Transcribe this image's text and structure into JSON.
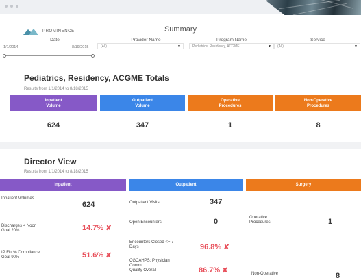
{
  "window": {
    "brand": "PROMINENCE",
    "title": "Summary"
  },
  "filters": {
    "date": {
      "label": "Date",
      "start": "1/1/2014",
      "end": "8/19/2015"
    },
    "provider": {
      "label": "Provider Name",
      "value": "(All)"
    },
    "program": {
      "label": "Program Name",
      "value": "Pediatrics, Residency, ACGME"
    },
    "service": {
      "label": "Service",
      "value": "(All)"
    }
  },
  "totals": {
    "heading": "Pediatrics, Residency, ACGME Totals",
    "results_note": "Results from 1/1/2014 to 8/18/2015",
    "cards": [
      {
        "line1": "Inpatient",
        "line2": "Volume",
        "value": "624",
        "color": "#8659c7"
      },
      {
        "line1": "Outpatient",
        "line2": "Volume",
        "value": "347",
        "color": "#3b86e8"
      },
      {
        "line1": "Operative",
        "line2": "Procedures",
        "value": "1",
        "color": "#ec7a1c"
      },
      {
        "line1": "Non-Operative",
        "line2": "Procedures",
        "value": "8",
        "color": "#ec7a1c"
      }
    ]
  },
  "director": {
    "heading": "Director View",
    "results_note": "Results from 1/1/2014 to 8/18/2015",
    "cards": [
      {
        "label": "Inpatient",
        "color": "#8659c7"
      },
      {
        "label": "Outpatient",
        "color": "#3b86e8"
      },
      {
        "label": "Surgery",
        "color": "#ec7a1c"
      }
    ],
    "inpatient": {
      "volumes_label": "Inpatient Volumes",
      "volumes_value": "624",
      "discharges_label1": "Discharges < Noon",
      "discharges_label2": "Goal 20%",
      "discharges_value": "14.7%",
      "flu_label1": "IP Flu % Compliance",
      "flu_label2": "Goal 90%",
      "flu_value": "51.6%"
    },
    "outpatient": {
      "visits_label": "Outpatient Visits",
      "visits_value": "347",
      "open_label": "Open Encounters",
      "open_value": "0",
      "closed_label1": "Encounters Closed <= 7",
      "closed_label2": "Days",
      "closed_value": "96.8%",
      "cgcahps_label1": "CGCAHPS: Physician",
      "cgcahps_label2": "Comm",
      "cgcahps_label3": "Quality Overall",
      "cgcahps_value": "86.7%"
    },
    "surgery": {
      "operative_label1": "Operative",
      "operative_label2": "Procedures",
      "operative_value": "1",
      "nonop_label": "Non-Operative",
      "nonop_value": "8"
    },
    "fail_mark": "✘"
  }
}
